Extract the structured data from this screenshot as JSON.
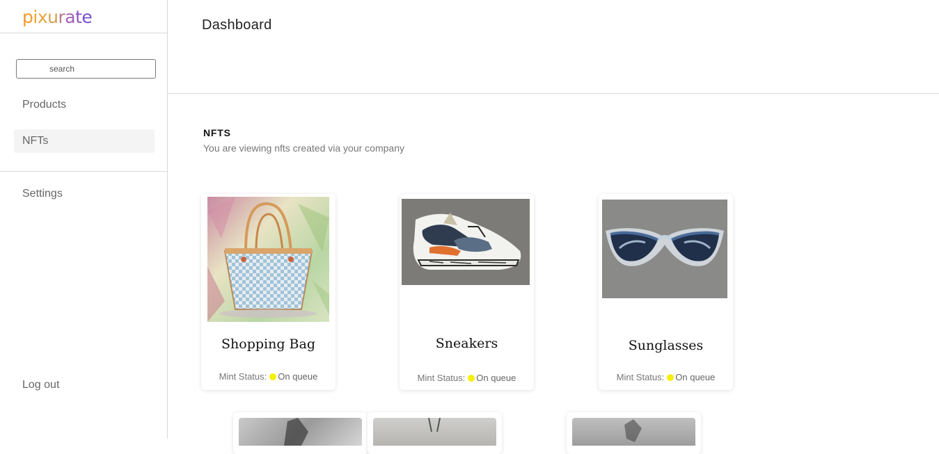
{
  "brand": {
    "logo_text": "pixurate",
    "logo_letters": [
      "p",
      "i",
      "x",
      "u",
      "r",
      "a",
      "t",
      "e"
    ],
    "logo_colors": [
      "#f39a2a",
      "#f2a52d",
      "#e9a53c",
      "#d3a04f",
      "#b87a8e",
      "#a25fb8",
      "#8f52c8",
      "#7c4fd3"
    ]
  },
  "sidebar": {
    "search_placeholder": "search",
    "items": [
      {
        "label": "Products"
      },
      {
        "label": "NFTs"
      },
      {
        "label": "Settings"
      }
    ],
    "logout_label": "Log out"
  },
  "header": {
    "title": "Dashboard"
  },
  "section": {
    "title": "NFTS",
    "subtitle": "You are viewing nfts created via your company"
  },
  "cards": [
    {
      "name": "Shopping Bag",
      "status_label": "Mint Status:",
      "status_value": "On queue",
      "status_color": "#f5ef0b"
    },
    {
      "name": "Sneakers",
      "status_label": "Mint Status:",
      "status_value": "On queue",
      "status_color": "#f5ef0b"
    },
    {
      "name": "Sunglasses",
      "status_label": "Mint Status:",
      "status_value": "On queue",
      "status_color": "#f5ef0b"
    }
  ],
  "colors": {
    "active_nav_bg": "#f4f4f4",
    "status_dot": "#f5ef0b"
  }
}
